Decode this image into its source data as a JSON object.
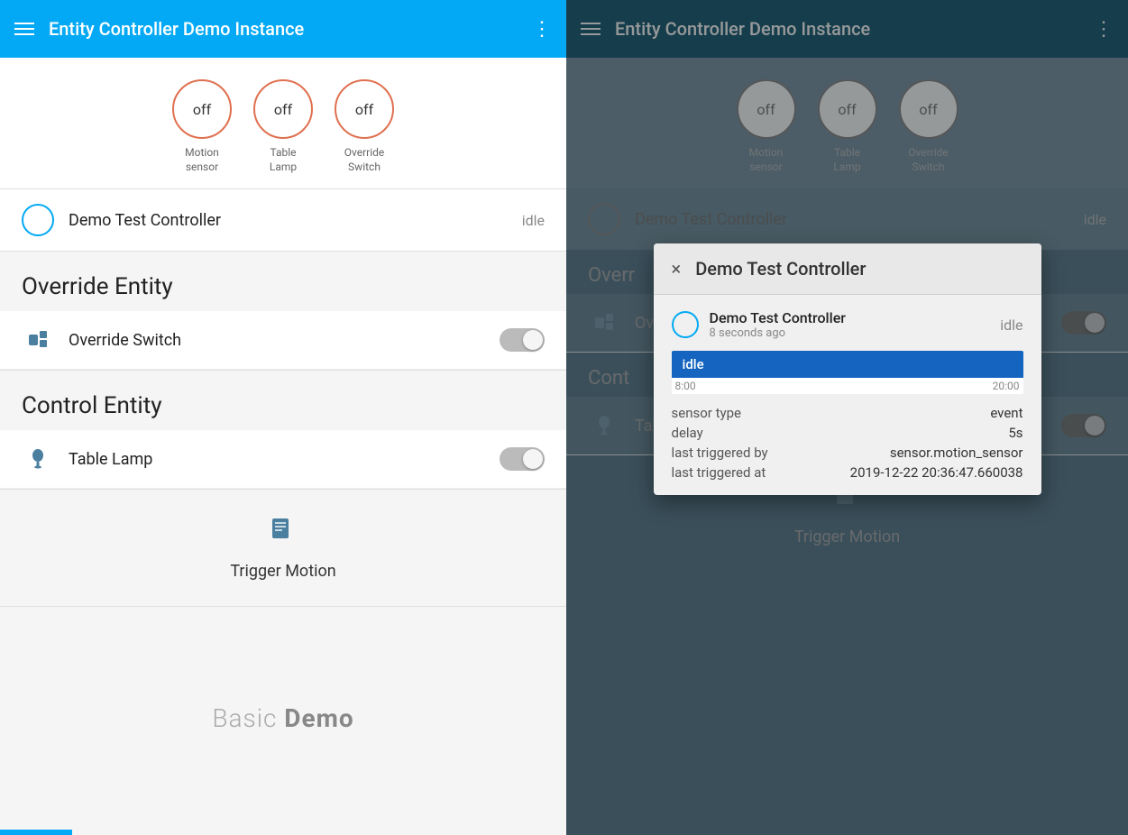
{
  "left": {
    "appBar": {
      "title": "Entity Controller Demo Instance",
      "menuIcon": "menu-icon",
      "moreIcon": "more-icon"
    },
    "sensors": [
      {
        "label_line1": "Motion",
        "label_line2": "sensor",
        "value": "off"
      },
      {
        "label_line1": "Table",
        "label_line2": "Lamp",
        "value": "off"
      },
      {
        "label_line1": "Override",
        "label_line2": "Switch",
        "value": "off"
      }
    ],
    "controller": {
      "name": "Demo Test Controller",
      "status": "idle"
    },
    "overrideEntity": {
      "sectionTitle": "Override Entity",
      "entityName": "Override Switch"
    },
    "controlEntity": {
      "sectionTitle": "Control Entity",
      "entityName": "Table Lamp"
    },
    "trigger": {
      "label": "Trigger Motion"
    },
    "basicDemo": {
      "text1": "Basic ",
      "text2": "Demo"
    }
  },
  "right": {
    "appBar": {
      "title": "Entity Controller Demo Instance"
    },
    "sensors": [
      {
        "label_line1": "Motion",
        "label_line2": "sensor",
        "value": "off"
      },
      {
        "label_line1": "Table",
        "label_line2": "Lamp",
        "value": "off"
      },
      {
        "label_line1": "Override",
        "label_line2": "Switch",
        "value": "off"
      }
    ],
    "controller": {
      "name": "Demo Test Controller",
      "status": "idle"
    },
    "overrideSectionTitle": "Overr",
    "controlSectionTitle": "Cont",
    "trigger": {
      "label": "Trigger Motion"
    }
  },
  "dialog": {
    "title": "Demo Test Controller",
    "closeLabel": "×",
    "controller": {
      "name": "Demo Test Controller",
      "timeAgo": "8 seconds ago",
      "status": "idle"
    },
    "timeline": {
      "idleLabel": "idle",
      "timeStart": "8:00",
      "timeEnd": "20:00"
    },
    "details": [
      {
        "key": "sensor type",
        "value": "event"
      },
      {
        "key": "delay",
        "value": "5s"
      },
      {
        "key": "last triggered by",
        "value": "sensor.motion_sensor"
      },
      {
        "key": "last triggered at",
        "value": "2019-12-22 20:36:47.660038"
      }
    ]
  }
}
